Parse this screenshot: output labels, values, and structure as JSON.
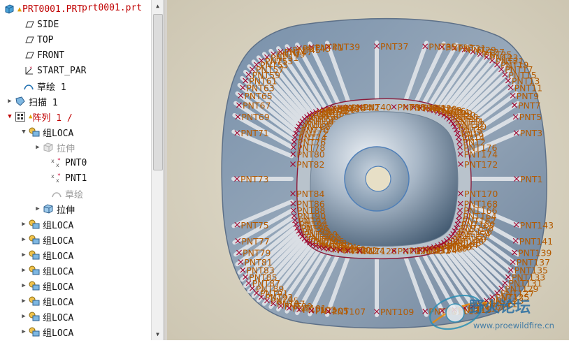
{
  "model_tree": {
    "root": {
      "label": "PRT0001.PRT",
      "icon": "part-icon"
    },
    "tab_title": "prt0001.prt",
    "items": [
      {
        "label": "SIDE",
        "icon": "datum-plane-icon"
      },
      {
        "label": "TOP",
        "icon": "datum-plane-icon"
      },
      {
        "label": "FRONT",
        "icon": "datum-plane-icon"
      },
      {
        "label": "START_PAR",
        "icon": "coordinate-system-icon"
      },
      {
        "label": "草绘 1",
        "icon": "sketch-icon"
      },
      {
        "label": "扫描 1",
        "icon": "sweep-icon"
      },
      {
        "label": "阵列 1 /",
        "icon": "pattern-icon"
      },
      {
        "label": "组LOCA",
        "icon": "group-icon"
      },
      {
        "label": "拉伸",
        "icon": "extrude-icon"
      },
      {
        "label": "PNT0",
        "icon": "datum-point-icon"
      },
      {
        "label": "PNT1",
        "icon": "datum-point-icon"
      },
      {
        "label": "草绘",
        "icon": "sketch-icon"
      },
      {
        "label": "拉伸",
        "icon": "extrude-icon"
      },
      {
        "label": "组LOCA",
        "icon": "group-icon"
      },
      {
        "label": "组LOCA",
        "icon": "group-icon"
      },
      {
        "label": "组LOCA",
        "icon": "group-icon"
      },
      {
        "label": "组LOCA",
        "icon": "group-icon"
      },
      {
        "label": "组LOCA",
        "icon": "group-icon"
      },
      {
        "label": "组LOCA",
        "icon": "group-icon"
      },
      {
        "label": "组LOCA",
        "icon": "group-icon"
      },
      {
        "label": "组LOCA",
        "icon": "group-icon"
      }
    ]
  },
  "viewport": {
    "background": "#d6d0bf",
    "model_color": "#8ea1b6",
    "point_label_color": "#b35a00",
    "point_marker_color": "#a0002a",
    "outer_points": [
      "PNT1",
      "PNT3",
      "PNT5",
      "PNT7",
      "PNT9",
      "PNT11",
      "PNT13",
      "PNT15",
      "PNT17",
      "PNT19",
      "PNT21",
      "PNT23",
      "PNT25",
      "PNT27",
      "PNT29",
      "PNT31",
      "PNT33",
      "PNT35",
      "PNT37",
      "PNT39",
      "PNT41",
      "PNT43",
      "PNT45",
      "PNT47",
      "PNT49",
      "PNT51",
      "PNT53",
      "PNT55",
      "PNT57",
      "PNT59",
      "PNT61",
      "PNT63",
      "PNT65",
      "PNT67",
      "PNT69",
      "PNT71",
      "PNT73",
      "PNT75",
      "PNT77",
      "PNT79",
      "PNT81",
      "PNT83",
      "PNT85",
      "PNT87",
      "PNT89",
      "PNT91",
      "PNT93",
      "PNT95",
      "PNT97",
      "PNT99",
      "PNT101",
      "PNT103",
      "PNT105",
      "PNT107",
      "PNT109",
      "PNT111",
      "PNT113",
      "PNT115",
      "PNT117",
      "PNT119",
      "PNT121",
      "PNT123",
      "PNT125",
      "PNT127",
      "PNT129",
      "PNT131",
      "PNT133",
      "PNT135",
      "PNT137",
      "PNT139",
      "PNT141",
      "PNT143"
    ],
    "inner_points": [
      "PNT2",
      "PNT4",
      "PNT6",
      "PNT8",
      "PNT10",
      "PNT12",
      "PNT14",
      "PNT16",
      "PNT18",
      "PNT20",
      "PNT22",
      "PNT24",
      "PNT26",
      "PNT28",
      "PNT30",
      "PNT32",
      "PNT34",
      "PNT36",
      "PNT38",
      "PNT40",
      "PNT42",
      "PNT44",
      "PNT46",
      "PNT48",
      "PNT50",
      "PNT52",
      "PNT54",
      "PNT56",
      "PNT58",
      "PNT60",
      "PNT62",
      "PNT64",
      "PNT66",
      "PNT68",
      "PNT70",
      "PNT72",
      "PNT74",
      "PNT76",
      "PNT78",
      "PNT80",
      "PNT82",
      "PNT84",
      "PNT86",
      "PNT88",
      "PNT90",
      "PNT92",
      "PNT94",
      "PNT96",
      "PNT98",
      "PNT100",
      "PNT102",
      "PNT104",
      "PNT106",
      "PNT108",
      "PNT110",
      "PNT112",
      "PNT114",
      "PNT116",
      "PNT118",
      "PNT120",
      "PNT122",
      "PNT124",
      "PNT126",
      "PNT128",
      "PNT130",
      "PNT132",
      "PNT134",
      "PNT136",
      "PNT138",
      "PNT140",
      "PNT142",
      "PNT144",
      "PNT146",
      "PNT148",
      "PNT150",
      "PNT152",
      "PNT154",
      "PNT156",
      "PNT158",
      "PNT160",
      "PNT162",
      "PNT164",
      "PNT166",
      "PNT168",
      "PNT170",
      "PNT172",
      "PNT174",
      "PNT176"
    ],
    "watermark": {
      "title": "野火论坛",
      "url": "www.proewildfire.cn"
    }
  }
}
